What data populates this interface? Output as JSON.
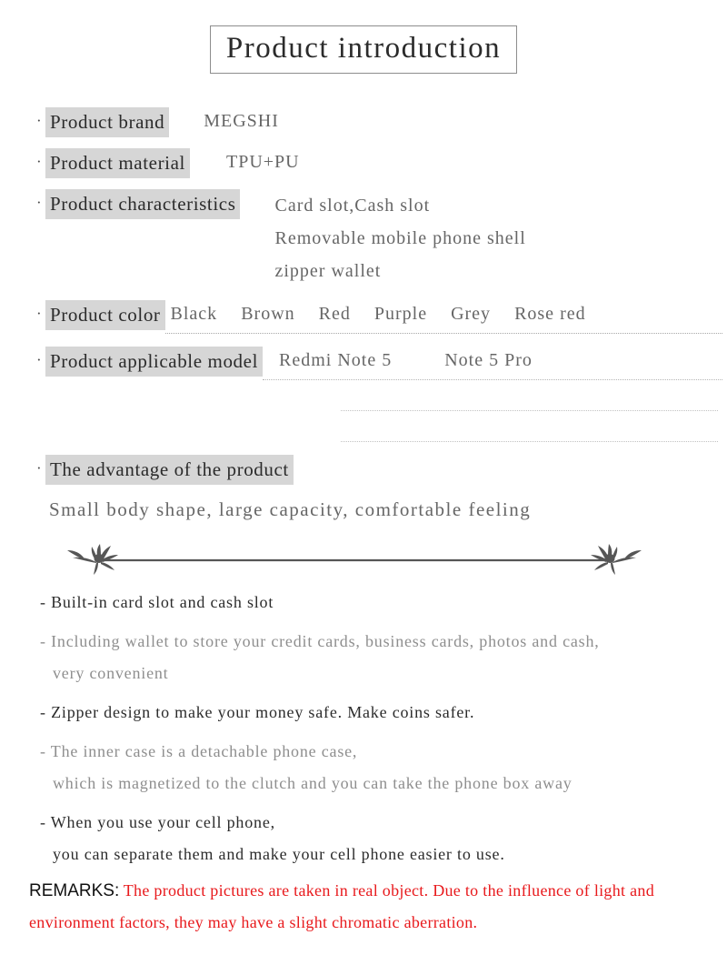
{
  "title": "Product introduction",
  "specs": [
    {
      "label": "Product brand",
      "value": "MEGSHI"
    },
    {
      "label": "Product material",
      "value": "TPU+PU"
    },
    {
      "label": "Product characteristics",
      "lines": [
        "Card slot,Cash slot",
        "Removable mobile phone shell",
        "zipper wallet"
      ]
    }
  ],
  "color_row": {
    "label": "Product color",
    "colors": [
      "Black",
      "Brown",
      "Red",
      "Purple",
      "Grey",
      "Rose red"
    ]
  },
  "model_row": {
    "label": "Product applicable model",
    "models": [
      "Redmi Note 5",
      "Note 5 Pro"
    ],
    "blank_line_count": 2
  },
  "advantage": {
    "label": "The advantage of the product",
    "tagline": "Small body shape, large capacity, comfortable feeling"
  },
  "features": [
    {
      "tone": "dark",
      "lines": [
        "- Built-in card slot and cash slot"
      ]
    },
    {
      "tone": "light",
      "lines": [
        "- Including wallet to store your credit cards, business cards, photos and cash,",
        "very convenient"
      ]
    },
    {
      "tone": "dark",
      "lines": [
        "- Zipper design to make your money safe. Make coins safer."
      ]
    },
    {
      "tone": "light",
      "lines": [
        "- The inner case is a detachable phone case,",
        "which is magnetized to the clutch and you can take the phone box away"
      ]
    },
    {
      "tone": "dark",
      "lines": [
        "- When you use your cell phone,",
        "you can separate them and make your cell phone easier to use."
      ]
    }
  ],
  "remarks": {
    "label": "REMARKS:",
    "text": "The product pictures are taken in real object. Due to the influence of light and environment factors, they may have a slight chromatic aberration."
  },
  "bullet_glyph": "·",
  "colors": {
    "highlight": "#d6d6d6",
    "label_text": "#2b2b2b",
    "value_text": "#666666",
    "muted_text": "#8e8e8e",
    "remark_red": "#e8191c",
    "ornament": "#565656"
  }
}
